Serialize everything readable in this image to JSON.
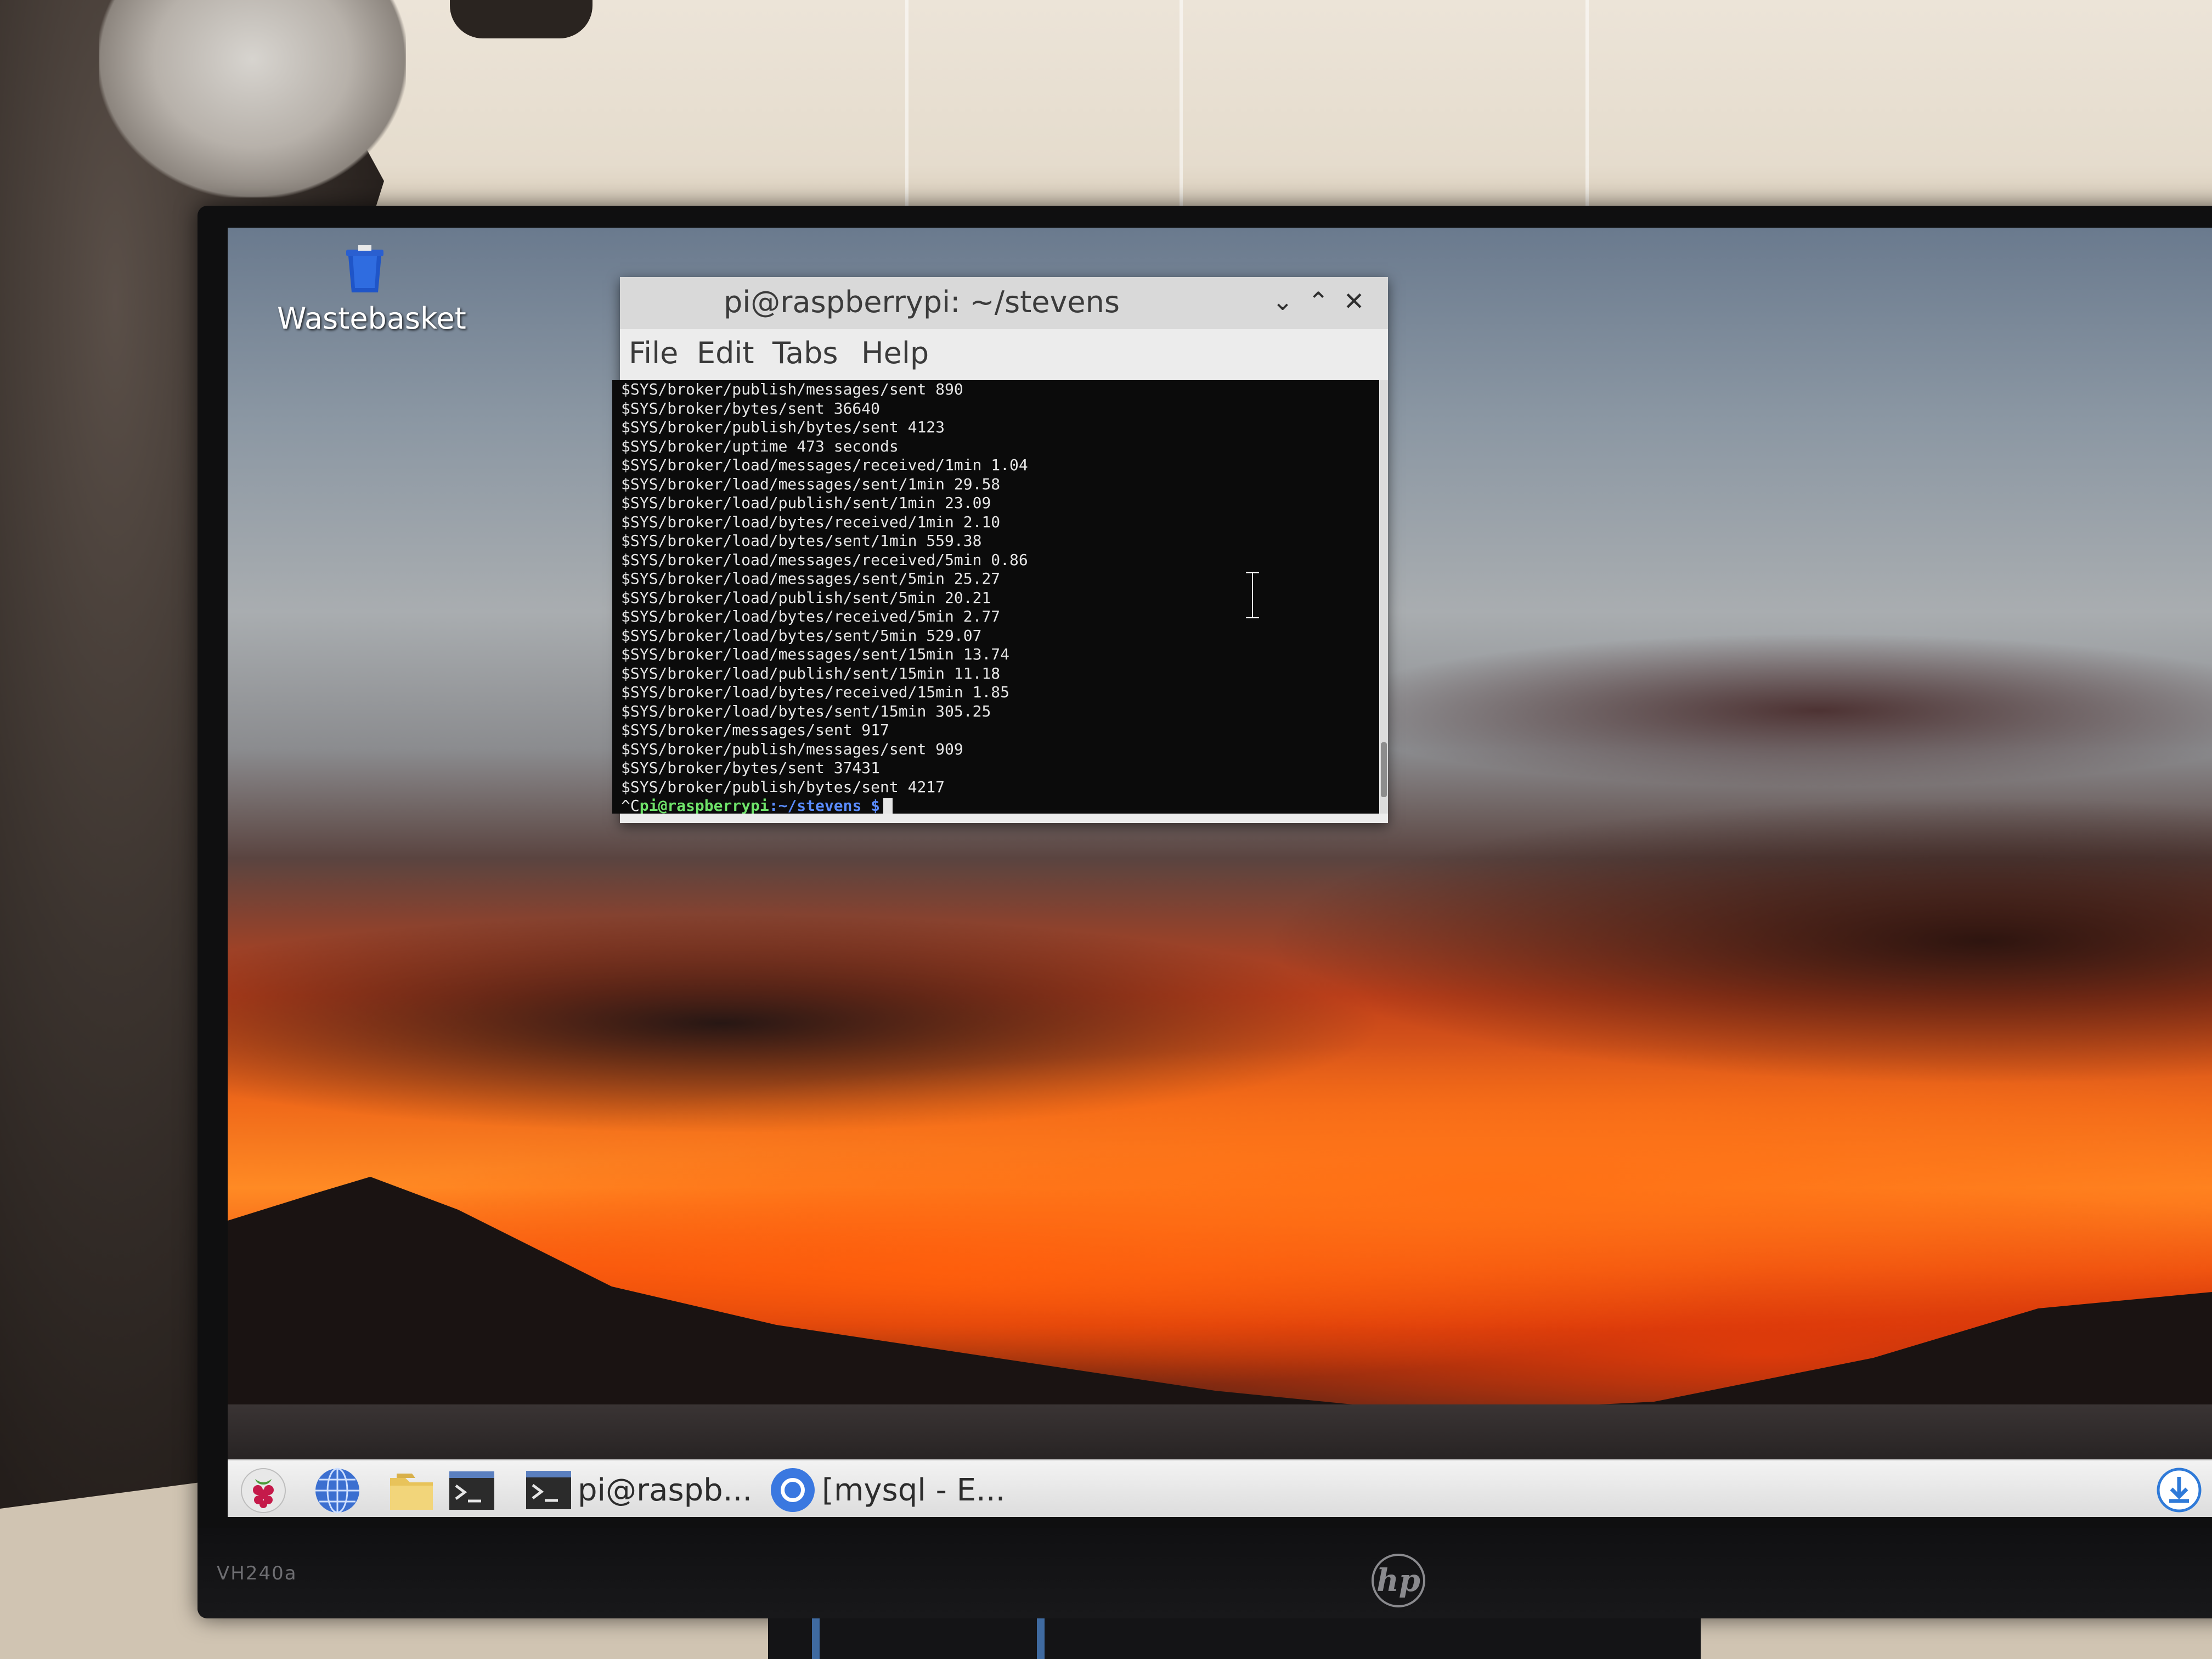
{
  "desktop": {
    "wallpaper": "sunset-over-lake",
    "icons": [
      {
        "label": "Wastebasket",
        "icon": "trash-icon"
      }
    ]
  },
  "terminal": {
    "title": "pi@raspberrypi: ~/stevens",
    "menu": [
      "File",
      "Edit",
      "Tabs",
      "Help"
    ],
    "lines": [
      "$SYS/broker/publish/messages/sent 890",
      "$SYS/broker/bytes/sent 36640",
      "$SYS/broker/publish/bytes/sent 4123",
      "$SYS/broker/uptime 473 seconds",
      "$SYS/broker/load/messages/received/1min 1.04",
      "$SYS/broker/load/messages/sent/1min 29.58",
      "$SYS/broker/load/publish/sent/1min 23.09",
      "$SYS/broker/load/bytes/received/1min 2.10",
      "$SYS/broker/load/bytes/sent/1min 559.38",
      "$SYS/broker/load/messages/received/5min 0.86",
      "$SYS/broker/load/messages/sent/5min 25.27",
      "$SYS/broker/load/publish/sent/5min 20.21",
      "$SYS/broker/load/bytes/received/5min 2.77",
      "$SYS/broker/load/bytes/sent/5min 529.07",
      "$SYS/broker/load/messages/sent/15min 13.74",
      "$SYS/broker/load/publish/sent/15min 11.18",
      "$SYS/broker/load/bytes/received/15min 1.85",
      "$SYS/broker/load/bytes/sent/15min 305.25",
      "$SYS/broker/messages/sent 917",
      "$SYS/broker/publish/messages/sent 909",
      "$SYS/broker/bytes/sent 37431",
      "$SYS/broker/publish/bytes/sent 4217"
    ],
    "prompt": {
      "prefix": "^C",
      "user": "pi@raspberrypi",
      "path": ":~/stevens $"
    }
  },
  "taskbar": {
    "launchers": [
      "raspberry-menu-icon",
      "web-browser-icon",
      "file-manager-icon",
      "terminal-icon"
    ],
    "windows": [
      {
        "label": "pi@raspb...",
        "icon": "terminal-icon"
      },
      {
        "label": "[mysql - E...",
        "icon": "chromium-icon"
      }
    ],
    "tray": [
      "download-icon"
    ]
  },
  "monitor": {
    "model": "VH240a",
    "brand": "hp"
  },
  "colors": {
    "terminal_bg": "#0b0b0b",
    "prompt_user": "#6fe36a",
    "prompt_path": "#5a8cff",
    "titlebar": "#d9d9d9"
  }
}
